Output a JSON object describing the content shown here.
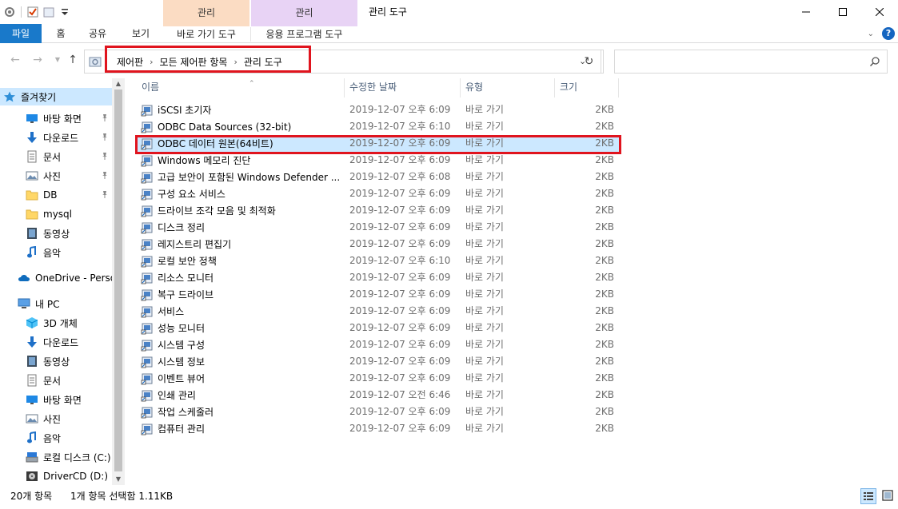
{
  "window": {
    "title": "관리 도구",
    "context_tab_1": "관리",
    "context_tab_2": "관리"
  },
  "ribbon": {
    "tabs": [
      "파일",
      "홈",
      "공유",
      "보기",
      "바로 가기 도구",
      "응용 프로그램 도구"
    ]
  },
  "address": {
    "breadcrumbs": [
      "제어판",
      "모든 제어판 항목",
      "관리 도구"
    ]
  },
  "search": {
    "placeholder": ""
  },
  "sidebar": {
    "items": [
      {
        "label": "즐겨찾기",
        "icon": "star-icon"
      },
      {
        "label": "바탕 화면",
        "icon": "desktop-icon"
      },
      {
        "label": "다운로드",
        "icon": "download-icon"
      },
      {
        "label": "문서",
        "icon": "document-icon"
      },
      {
        "label": "사진",
        "icon": "picture-icon"
      },
      {
        "label": "DB",
        "icon": "folder-icon"
      },
      {
        "label": "mysql",
        "icon": "folder-icon"
      },
      {
        "label": "동영상",
        "icon": "video-icon"
      },
      {
        "label": "음악",
        "icon": "music-icon"
      },
      {
        "label": "OneDrive - Perso",
        "icon": "cloud-icon"
      },
      {
        "label": "내 PC",
        "icon": "pc-icon"
      },
      {
        "label": "3D 개체",
        "icon": "3d-object-icon"
      },
      {
        "label": "다운로드",
        "icon": "download-icon"
      },
      {
        "label": "동영상",
        "icon": "video-icon"
      },
      {
        "label": "문서",
        "icon": "document-icon"
      },
      {
        "label": "바탕 화면",
        "icon": "desktop-icon"
      },
      {
        "label": "사진",
        "icon": "picture-icon"
      },
      {
        "label": "음악",
        "icon": "music-icon"
      },
      {
        "label": "로컬 디스크 (C:)",
        "icon": "drive-icon"
      },
      {
        "label": "DriverCD (D:)",
        "icon": "cd-drive-icon"
      }
    ]
  },
  "columns": {
    "name": "이름",
    "date": "수정한 날짜",
    "type": "유형",
    "size": "크기"
  },
  "files": [
    {
      "name": "iSCSI 초기자",
      "date": "2019-12-07 오후 6:09",
      "type": "바로 가기",
      "size": "2KB"
    },
    {
      "name": "ODBC Data Sources (32-bit)",
      "date": "2019-12-07 오후 6:10",
      "type": "바로 가기",
      "size": "2KB"
    },
    {
      "name": "ODBC 데이터 원본(64비트)",
      "date": "2019-12-07 오후 6:09",
      "type": "바로 가기",
      "size": "2KB"
    },
    {
      "name": "Windows 메모리 진단",
      "date": "2019-12-07 오후 6:09",
      "type": "바로 가기",
      "size": "2KB"
    },
    {
      "name": "고급 보안이 포함된 Windows Defender ...",
      "date": "2019-12-07 오후 6:08",
      "type": "바로 가기",
      "size": "2KB"
    },
    {
      "name": "구성 요소 서비스",
      "date": "2019-12-07 오후 6:09",
      "type": "바로 가기",
      "size": "2KB"
    },
    {
      "name": "드라이브 조각 모음 및 최적화",
      "date": "2019-12-07 오후 6:09",
      "type": "바로 가기",
      "size": "2KB"
    },
    {
      "name": "디스크 정리",
      "date": "2019-12-07 오후 6:09",
      "type": "바로 가기",
      "size": "2KB"
    },
    {
      "name": "레지스트리 편집기",
      "date": "2019-12-07 오후 6:09",
      "type": "바로 가기",
      "size": "2KB"
    },
    {
      "name": "로컬 보안 정책",
      "date": "2019-12-07 오후 6:10",
      "type": "바로 가기",
      "size": "2KB"
    },
    {
      "name": "리소스 모니터",
      "date": "2019-12-07 오후 6:09",
      "type": "바로 가기",
      "size": "2KB"
    },
    {
      "name": "복구 드라이브",
      "date": "2019-12-07 오후 6:09",
      "type": "바로 가기",
      "size": "2KB"
    },
    {
      "name": "서비스",
      "date": "2019-12-07 오후 6:09",
      "type": "바로 가기",
      "size": "2KB"
    },
    {
      "name": "성능 모니터",
      "date": "2019-12-07 오후 6:09",
      "type": "바로 가기",
      "size": "2KB"
    },
    {
      "name": "시스템 구성",
      "date": "2019-12-07 오후 6:09",
      "type": "바로 가기",
      "size": "2KB"
    },
    {
      "name": "시스템 정보",
      "date": "2019-12-07 오후 6:09",
      "type": "바로 가기",
      "size": "2KB"
    },
    {
      "name": "이벤트 뷰어",
      "date": "2019-12-07 오후 6:09",
      "type": "바로 가기",
      "size": "2KB"
    },
    {
      "name": "인쇄 관리",
      "date": "2019-12-07 오전 6:46",
      "type": "바로 가기",
      "size": "2KB"
    },
    {
      "name": "작업 스케줄러",
      "date": "2019-12-07 오후 6:09",
      "type": "바로 가기",
      "size": "2KB"
    },
    {
      "name": "컴퓨터 관리",
      "date": "2019-12-07 오후 6:09",
      "type": "바로 가기",
      "size": "2KB"
    }
  ],
  "status": {
    "item_count": "20개 항목",
    "selection": "1개 항목 선택함 1.11KB"
  },
  "colors": {
    "file_tab": "#1979ca",
    "selection": "#cce8ff",
    "highlight_box": "#e0141e",
    "context_orange": "#fbdcc3",
    "context_purple": "#e8d3f5"
  }
}
